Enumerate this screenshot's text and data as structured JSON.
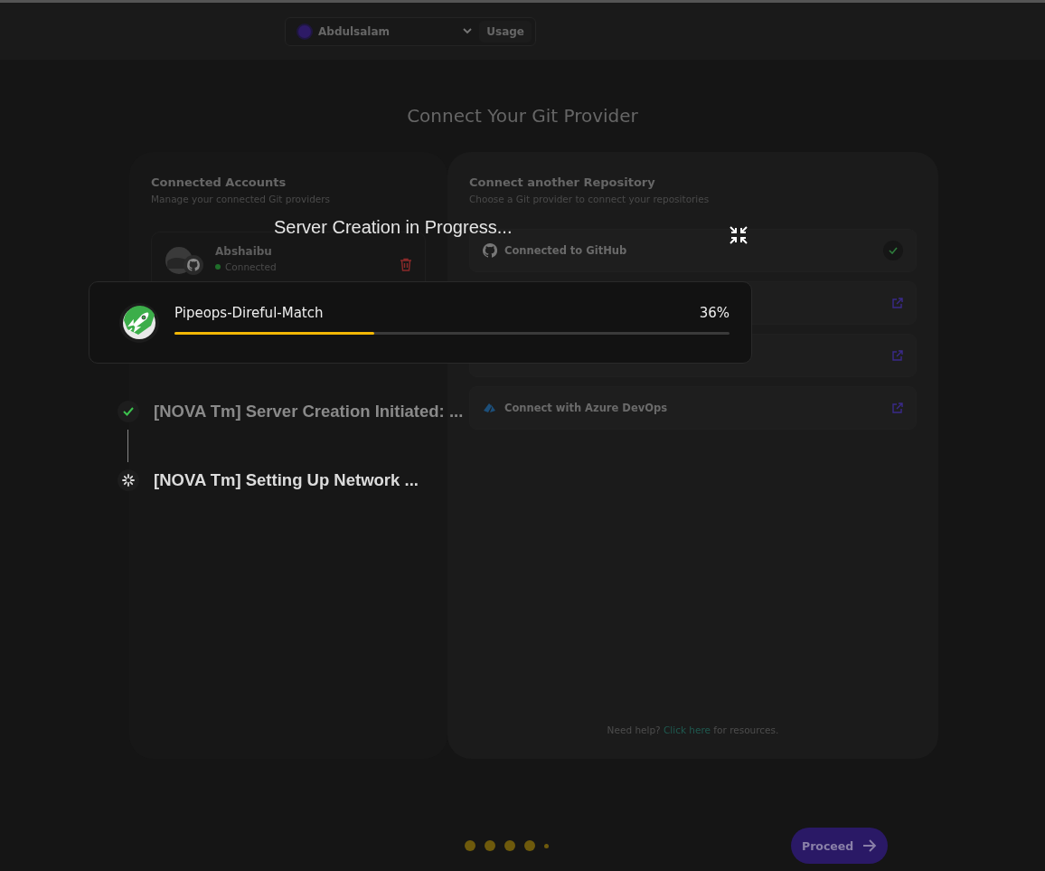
{
  "header": {
    "workspace": "Abdulsalam",
    "usage_button": "Usage"
  },
  "title": "Connect Your Git Provider",
  "connected_accounts": {
    "title": "Connected Accounts",
    "subtitle": "Manage your connected Git providers",
    "accounts": [
      {
        "name": "Abshaibu",
        "status": "Connected"
      }
    ]
  },
  "connect_repository": {
    "title": "Connect another Repository",
    "subtitle": "Choose a Git provider to connect your repositories",
    "providers": [
      {
        "kind": "github",
        "label": "Connected to GitHub",
        "connected": true
      },
      {
        "kind": "hidden",
        "connected": false
      },
      {
        "kind": "hidden",
        "connected": false
      },
      {
        "kind": "azure",
        "label": "Connect with Azure DevOps",
        "connected": false
      }
    ],
    "help": {
      "before": "Need help?",
      "link": "Click here",
      "after": "for resources."
    }
  },
  "step_dots": [
    {
      "completed": true
    },
    {
      "completed": true
    },
    {
      "completed": true
    },
    {
      "completed": true
    },
    {
      "completed": false
    }
  ],
  "proceed_button": "Proceed",
  "progress_overlay": {
    "title": "Server Creation in Progress...",
    "server_name": "Pipeops-Direful-Match",
    "percent": "36%",
    "level": 0.36,
    "steps": [
      {
        "kind": "done",
        "label": "[NOVA Tm] Server Creation Initiated: ..."
      },
      {
        "kind": "loading",
        "label": "[NOVA Tm] Setting Up Network ..."
      }
    ]
  }
}
